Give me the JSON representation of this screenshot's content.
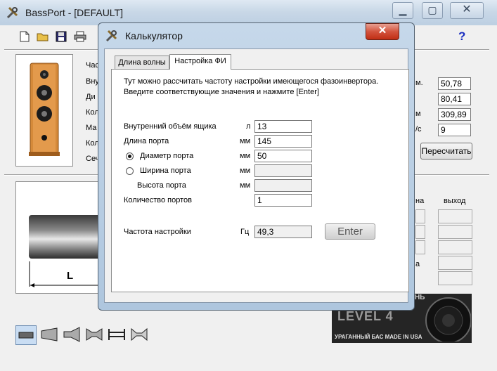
{
  "main_window": {
    "title": "BassPort - [DEFAULT]",
    "toolbar": {
      "help_label": "?"
    },
    "left_labels": [
      "Час",
      "Вну",
      "Ди",
      "Кол",
      "Ма",
      "Кол",
      "Сеч"
    ],
    "right_labels": [
      "м.",
      "м",
      "/с"
    ],
    "right_values": [
      "50,78",
      "80,41",
      "309,89",
      "9"
    ],
    "recalc_button": "Пересчитать",
    "col_headers": [
      "на",
      "выход"
    ],
    "side_label_a": "а",
    "diagram_label": "L",
    "ad_banner": {
      "top_text": "НЬ",
      "brand": "LEVEL 4",
      "tagline": "УРАГАННЫЙ БАС MADE IN USA"
    }
  },
  "dialog": {
    "title": "Калькулятор",
    "tabs": [
      {
        "label": "Длина волны",
        "active": false
      },
      {
        "label": "Настройка ФИ",
        "active": true
      }
    ],
    "intro_line1": "Тут можно рассчитать частоту настройки имеющегося фазоинвертора.",
    "intro_line2": "Введите соответствующие значения и нажмите  [Enter]",
    "rows": [
      {
        "label": "Внутренний объём ящика",
        "unit": "л",
        "value": "13"
      },
      {
        "label": "Длина порта",
        "unit": "мм",
        "value": "145"
      },
      {
        "label": "Диаметр порта",
        "unit": "мм",
        "value": "50"
      },
      {
        "label": "Ширина порта",
        "unit": "мм",
        "value": ""
      },
      {
        "label": "Высота порта",
        "unit": "мм",
        "value": ""
      },
      {
        "label": "Количество портов",
        "unit": "",
        "value": "1"
      }
    ],
    "result": {
      "label": "Частота настройки",
      "unit": "Гц",
      "value": "49,3"
    },
    "enter_button": "Enter"
  }
}
